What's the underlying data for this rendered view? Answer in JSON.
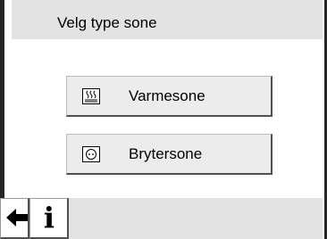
{
  "header": {
    "title": "Velg type sone"
  },
  "zones": [
    {
      "label": "Varmesone",
      "icon": "heat-icon"
    },
    {
      "label": "Brytersone",
      "icon": "switch-icon"
    }
  ],
  "footer": {
    "back_icon": "arrow-left-icon",
    "info_glyph": "i",
    "info_icon": "info-icon"
  },
  "colors": {
    "header_bg": "#e3e3e3",
    "button_bg": "#ececec",
    "frame": "#262626",
    "text": "#000000"
  }
}
